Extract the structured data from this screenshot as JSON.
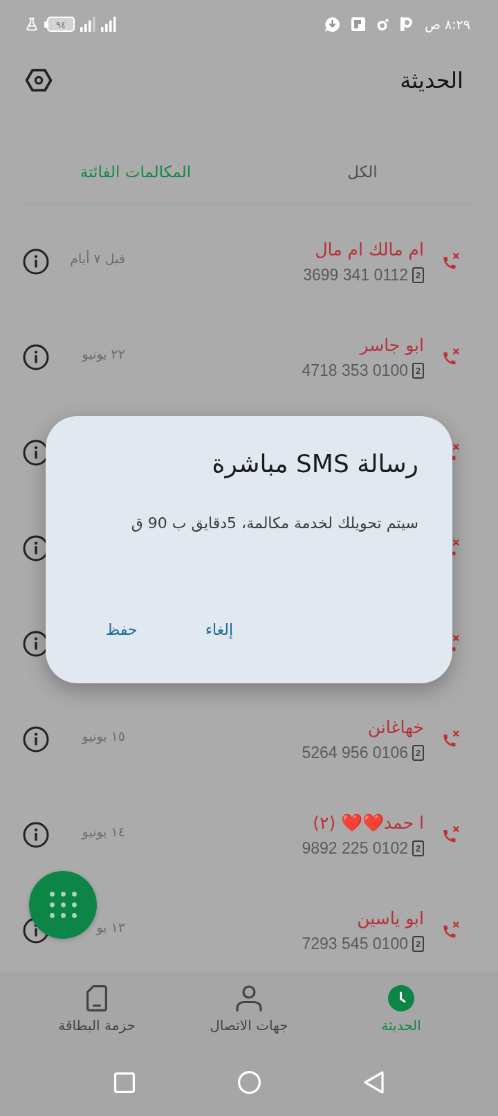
{
  "status_bar": {
    "time": "٨:٢٩ ص",
    "battery": "٩٤"
  },
  "header": {
    "title": "الحديثة"
  },
  "tabs": [
    {
      "label": "الكل",
      "selected": false
    },
    {
      "label": "المكالمات الفائتة",
      "selected": true
    }
  ],
  "calls": [
    {
      "kind": "missed",
      "name": "ام مالك ام مال",
      "sim": "2",
      "number": "3699 341 0112",
      "date": "قبل ٧ أيام"
    },
    {
      "kind": "missed",
      "name": "ابو جاسر",
      "sim": "2",
      "number": "4718 353 0100",
      "date": "٢٢ يونيو"
    },
    {
      "kind": "missed"
    },
    {
      "kind": "missed"
    },
    {
      "kind": "missed"
    },
    {
      "kind": "missed",
      "name": "خهاغانن",
      "sim": "2",
      "number": "5264 956 0106",
      "date": "١٥ يونيو"
    },
    {
      "kind": "missed",
      "name": "ا حمد❤️❤️ (٢)",
      "sim": "2",
      "number": "9892 225 0102",
      "date": "١٤ يونيو"
    },
    {
      "kind": "missed",
      "name": "ابو ياسين",
      "sim": "2",
      "number": "7293 545 0100",
      "date": "١٣ يو"
    }
  ],
  "dialog": {
    "title": "رسالة SMS مباشرة",
    "message": "سيتم تحويلك لخدمة مكالمة، 5دقايق ب 90 ق",
    "buttons": [
      "إلغاء",
      "حفظ"
    ]
  },
  "bottom_nav": [
    {
      "label": "الحديثة",
      "selected": true
    },
    {
      "label": "جهات الاتصال",
      "selected": false
    },
    {
      "label": "حزمة البطاقة",
      "selected": false
    }
  ]
}
